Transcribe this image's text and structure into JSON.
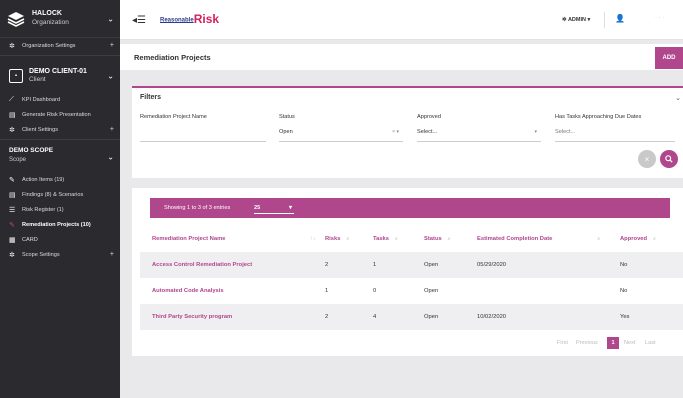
{
  "sidebar": {
    "org": {
      "title": "HALOCK",
      "subtitle": "Organization"
    },
    "org_items": [
      {
        "label": "Organization Settings",
        "icon": "gear-icon"
      }
    ],
    "client": {
      "title": "DEMO CLIENT-01",
      "subtitle": "Client"
    },
    "client_items": [
      {
        "label": "KPI Dashboard",
        "icon": "chart-icon"
      },
      {
        "label": "Generate Risk Presentation",
        "icon": "document-icon"
      },
      {
        "label": "Client Settings",
        "icon": "gear-icon"
      }
    ],
    "scope": {
      "title": "DEMO SCOPE",
      "subtitle": "Scope"
    },
    "scope_items": [
      {
        "label": "Action Items (19)",
        "icon": "edit-icon"
      },
      {
        "label": "Findings (8) & Scenarios",
        "icon": "document-icon"
      },
      {
        "label": "Risk Register (1)",
        "icon": "list-icon"
      },
      {
        "label": "Remediation Projects (10)",
        "icon": "edit-icon"
      },
      {
        "label": "CARD",
        "icon": "grid-icon"
      },
      {
        "label": "Scope Settings",
        "icon": "gear-icon"
      }
    ]
  },
  "topbar": {
    "brand_part1": "Reasonable",
    "brand_part2": "Risk",
    "admin_label": "ADMIN",
    "more": "· · ·"
  },
  "page": {
    "title": "Remediation Projects",
    "add_label": "ADD"
  },
  "filters": {
    "title": "Filters",
    "fields": [
      {
        "label": "Remediation Project Name",
        "value": ""
      },
      {
        "label": "Status",
        "value": "Open"
      },
      {
        "label": "Approved",
        "value": "Select..."
      },
      {
        "label": "Has Tasks Approaching Due Dates",
        "value": "Select..."
      }
    ]
  },
  "table": {
    "showing": "Showing 1 to 3 of 3 entries",
    "page_length": "25",
    "columns": [
      "Remediation Project Name",
      "Risks",
      "Tasks",
      "Status",
      "Estimated Completion Date",
      "Approved"
    ],
    "rows": [
      {
        "name": "Access Control Remediation Project",
        "risks": "2",
        "tasks": "1",
        "status": "Open",
        "date": "05/29/2020",
        "approved": "No"
      },
      {
        "name": "Automated Code Analysis",
        "risks": "1",
        "tasks": "0",
        "status": "Open",
        "date": "",
        "approved": "No"
      },
      {
        "name": "Third Party Security program",
        "risks": "2",
        "tasks": "4",
        "status": "Open",
        "date": "10/02/2020",
        "approved": "Yes"
      }
    ],
    "pagination": {
      "first": "First",
      "previous": "Previous",
      "current": "1",
      "next": "Next",
      "last": "Last"
    }
  },
  "colors": {
    "accent": "#b0468c",
    "sidebar_bg": "#2b2b2f",
    "brand_blue": "#2d3c8c",
    "brand_red": "#d5205c"
  }
}
